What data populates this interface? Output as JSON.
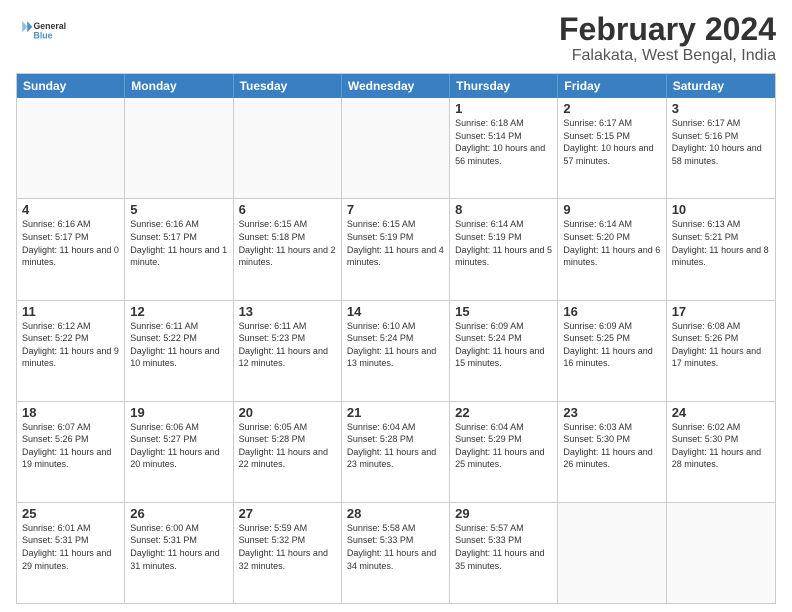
{
  "logo": {
    "text_general": "General",
    "text_blue": "Blue"
  },
  "title": "February 2024",
  "subtitle": "Falakata, West Bengal, India",
  "header_days": [
    "Sunday",
    "Monday",
    "Tuesday",
    "Wednesday",
    "Thursday",
    "Friday",
    "Saturday"
  ],
  "weeks": [
    [
      {
        "day": "",
        "empty": true
      },
      {
        "day": "",
        "empty": true
      },
      {
        "day": "",
        "empty": true
      },
      {
        "day": "",
        "empty": true
      },
      {
        "day": "1",
        "sunrise": "6:18 AM",
        "sunset": "5:14 PM",
        "daylight": "10 hours and 56 minutes."
      },
      {
        "day": "2",
        "sunrise": "6:17 AM",
        "sunset": "5:15 PM",
        "daylight": "10 hours and 57 minutes."
      },
      {
        "day": "3",
        "sunrise": "6:17 AM",
        "sunset": "5:16 PM",
        "daylight": "10 hours and 58 minutes."
      }
    ],
    [
      {
        "day": "4",
        "sunrise": "6:16 AM",
        "sunset": "5:17 PM",
        "daylight": "11 hours and 0 minutes."
      },
      {
        "day": "5",
        "sunrise": "6:16 AM",
        "sunset": "5:17 PM",
        "daylight": "11 hours and 1 minute."
      },
      {
        "day": "6",
        "sunrise": "6:15 AM",
        "sunset": "5:18 PM",
        "daylight": "11 hours and 2 minutes."
      },
      {
        "day": "7",
        "sunrise": "6:15 AM",
        "sunset": "5:19 PM",
        "daylight": "11 hours and 4 minutes."
      },
      {
        "day": "8",
        "sunrise": "6:14 AM",
        "sunset": "5:19 PM",
        "daylight": "11 hours and 5 minutes."
      },
      {
        "day": "9",
        "sunrise": "6:14 AM",
        "sunset": "5:20 PM",
        "daylight": "11 hours and 6 minutes."
      },
      {
        "day": "10",
        "sunrise": "6:13 AM",
        "sunset": "5:21 PM",
        "daylight": "11 hours and 8 minutes."
      }
    ],
    [
      {
        "day": "11",
        "sunrise": "6:12 AM",
        "sunset": "5:22 PM",
        "daylight": "11 hours and 9 minutes."
      },
      {
        "day": "12",
        "sunrise": "6:11 AM",
        "sunset": "5:22 PM",
        "daylight": "11 hours and 10 minutes."
      },
      {
        "day": "13",
        "sunrise": "6:11 AM",
        "sunset": "5:23 PM",
        "daylight": "11 hours and 12 minutes."
      },
      {
        "day": "14",
        "sunrise": "6:10 AM",
        "sunset": "5:24 PM",
        "daylight": "11 hours and 13 minutes."
      },
      {
        "day": "15",
        "sunrise": "6:09 AM",
        "sunset": "5:24 PM",
        "daylight": "11 hours and 15 minutes."
      },
      {
        "day": "16",
        "sunrise": "6:09 AM",
        "sunset": "5:25 PM",
        "daylight": "11 hours and 16 minutes."
      },
      {
        "day": "17",
        "sunrise": "6:08 AM",
        "sunset": "5:26 PM",
        "daylight": "11 hours and 17 minutes."
      }
    ],
    [
      {
        "day": "18",
        "sunrise": "6:07 AM",
        "sunset": "5:26 PM",
        "daylight": "11 hours and 19 minutes."
      },
      {
        "day": "19",
        "sunrise": "6:06 AM",
        "sunset": "5:27 PM",
        "daylight": "11 hours and 20 minutes."
      },
      {
        "day": "20",
        "sunrise": "6:05 AM",
        "sunset": "5:28 PM",
        "daylight": "11 hours and 22 minutes."
      },
      {
        "day": "21",
        "sunrise": "6:04 AM",
        "sunset": "5:28 PM",
        "daylight": "11 hours and 23 minutes."
      },
      {
        "day": "22",
        "sunrise": "6:04 AM",
        "sunset": "5:29 PM",
        "daylight": "11 hours and 25 minutes."
      },
      {
        "day": "23",
        "sunrise": "6:03 AM",
        "sunset": "5:30 PM",
        "daylight": "11 hours and 26 minutes."
      },
      {
        "day": "24",
        "sunrise": "6:02 AM",
        "sunset": "5:30 PM",
        "daylight": "11 hours and 28 minutes."
      }
    ],
    [
      {
        "day": "25",
        "sunrise": "6:01 AM",
        "sunset": "5:31 PM",
        "daylight": "11 hours and 29 minutes."
      },
      {
        "day": "26",
        "sunrise": "6:00 AM",
        "sunset": "5:31 PM",
        "daylight": "11 hours and 31 minutes."
      },
      {
        "day": "27",
        "sunrise": "5:59 AM",
        "sunset": "5:32 PM",
        "daylight": "11 hours and 32 minutes."
      },
      {
        "day": "28",
        "sunrise": "5:58 AM",
        "sunset": "5:33 PM",
        "daylight": "11 hours and 34 minutes."
      },
      {
        "day": "29",
        "sunrise": "5:57 AM",
        "sunset": "5:33 PM",
        "daylight": "11 hours and 35 minutes."
      },
      {
        "day": "",
        "empty": true
      },
      {
        "day": "",
        "empty": true
      }
    ]
  ]
}
